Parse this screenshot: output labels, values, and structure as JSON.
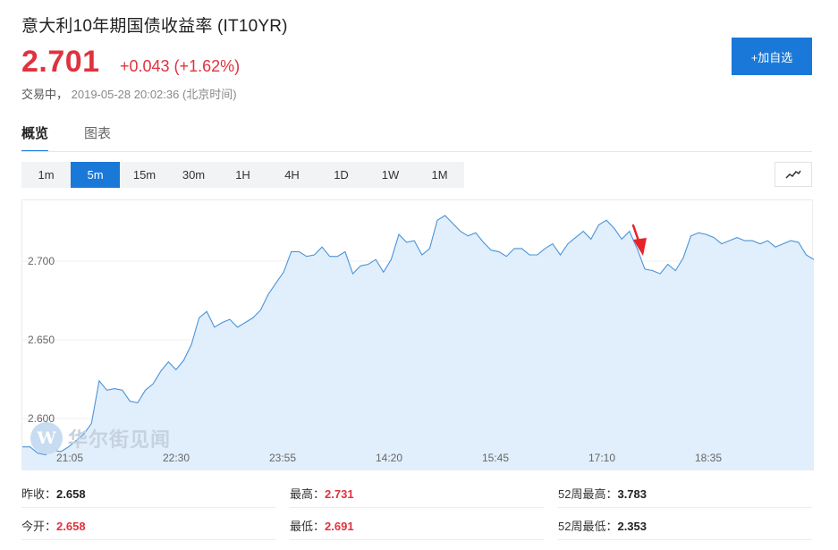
{
  "header": {
    "title": "意大利10年期国债收益率 (IT10YR)",
    "price": "2.701",
    "change": "+0.043 (+1.62%)",
    "status_state": "交易中，",
    "status_time": "2019-05-28 20:02:36 (北京时间)",
    "add_button": "+加自选"
  },
  "tabs": [
    {
      "label": "概览",
      "active": true
    },
    {
      "label": "图表",
      "active": false
    }
  ],
  "periods": [
    {
      "label": "1m",
      "active": false
    },
    {
      "label": "5m",
      "active": true
    },
    {
      "label": "15m",
      "active": false
    },
    {
      "label": "30m",
      "active": false
    },
    {
      "label": "1H",
      "active": false
    },
    {
      "label": "4H",
      "active": false
    },
    {
      "label": "1D",
      "active": false
    },
    {
      "label": "1W",
      "active": false
    },
    {
      "label": "1M",
      "active": false
    }
  ],
  "chart_type_icon": "line-chart-icon",
  "watermark": {
    "logo_letter": "W",
    "text": "华尔街见闻"
  },
  "colors": {
    "accent": "#1a78d9",
    "up": "#e0323f",
    "line": "#4a94d9",
    "fill": "#e1eefb"
  },
  "chart_data": {
    "type": "area",
    "y_ticks": [
      "2.600",
      "2.650",
      "2.700"
    ],
    "x_ticks": [
      "21:05",
      "22:30",
      "23:55",
      "14:20",
      "15:45",
      "17:10",
      "18:35"
    ],
    "ylim": [
      2.582,
      2.732
    ],
    "grid": "horizontal",
    "values": [
      2.582,
      2.582,
      2.578,
      2.577,
      2.58,
      2.579,
      2.582,
      2.586,
      2.59,
      2.597,
      2.624,
      2.618,
      2.619,
      2.618,
      2.611,
      2.61,
      2.618,
      2.622,
      2.63,
      2.636,
      2.631,
      2.637,
      2.647,
      2.664,
      2.668,
      2.658,
      2.661,
      2.663,
      2.658,
      2.661,
      2.664,
      2.669,
      2.679,
      2.686,
      2.693,
      2.706,
      2.706,
      2.703,
      2.704,
      2.709,
      2.703,
      2.703,
      2.706,
      2.692,
      2.697,
      2.698,
      2.701,
      2.693,
      2.701,
      2.717,
      2.712,
      2.713,
      2.704,
      2.708,
      2.726,
      2.729,
      2.724,
      2.719,
      2.716,
      2.718,
      2.712,
      2.707,
      2.706,
      2.703,
      2.708,
      2.708,
      2.704,
      2.704,
      2.708,
      2.711,
      2.704,
      2.711,
      2.715,
      2.719,
      2.714,
      2.723,
      2.726,
      2.721,
      2.714,
      2.719,
      2.708,
      2.695,
      2.694,
      2.692,
      2.698,
      2.694,
      2.702,
      2.716,
      2.718,
      2.717,
      2.715,
      2.711,
      2.713,
      2.715,
      2.713,
      2.713,
      2.711,
      2.713,
      2.709,
      2.711,
      2.713,
      2.712,
      2.704,
      2.701
    ]
  },
  "annotation": {
    "type": "red-arrow",
    "target_time": "17:25"
  },
  "stats": {
    "prev_close_label": "昨收：",
    "prev_close": "2.658",
    "high_label": "最高：",
    "high": "2.731",
    "high52_label": "52周最高：",
    "high52": "3.783",
    "open_label": "今开：",
    "open": "2.658",
    "low_label": "最低：",
    "low": "2.691",
    "low52_label": "52周最低：",
    "low52": "2.353"
  }
}
